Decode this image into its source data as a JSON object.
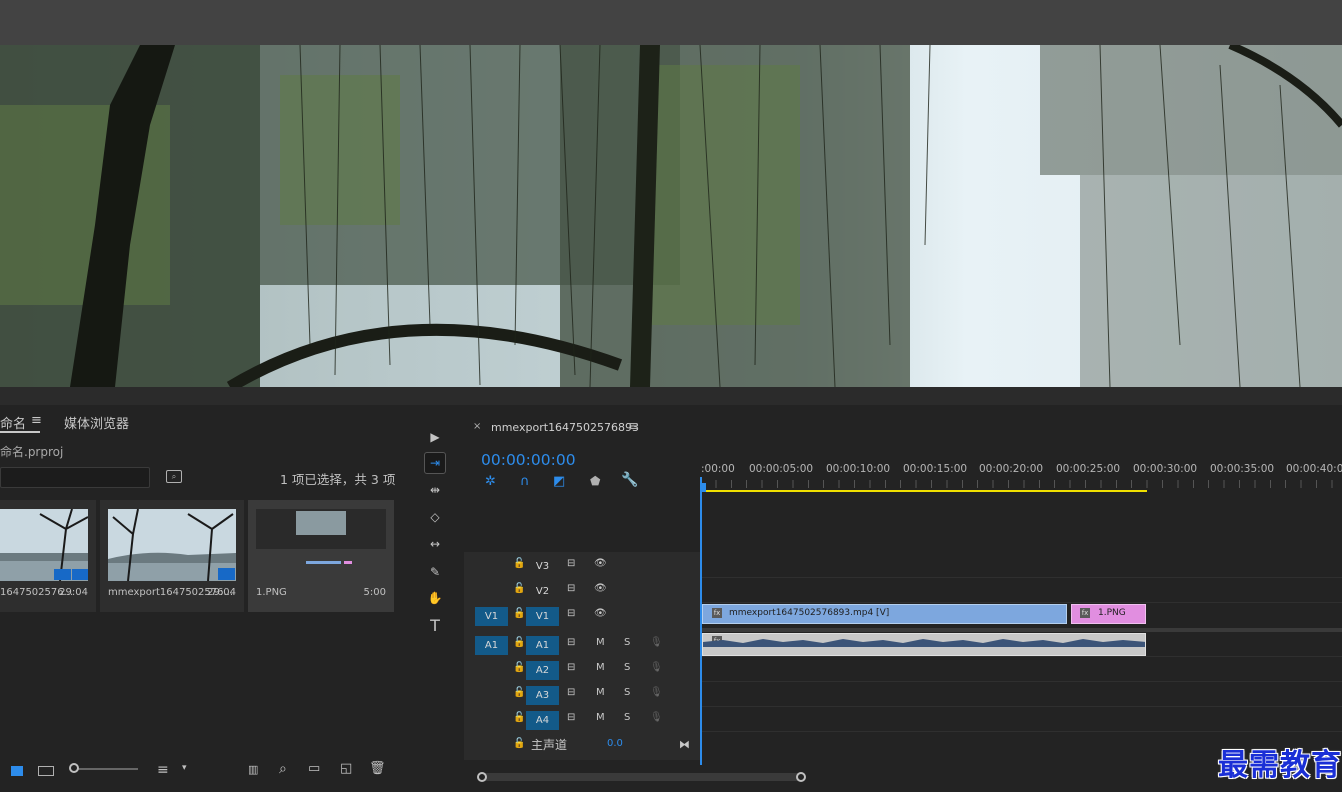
{
  "colors": {
    "accent": "#2d8ceb",
    "panel": "#232323",
    "track_header_active": "#135a89",
    "clip_video": "#7da7de",
    "clip_image": "#e18ee0",
    "work_area": "#f0e000"
  },
  "project": {
    "tab_project": "命名",
    "tab_menu_icon": "hamburger-icon",
    "tab_media_browser": "媒体浏览器",
    "project_file": "命名.prproj",
    "selection_status": "1 项已选择，共 3 项",
    "items": [
      {
        "name": "1647502576...",
        "duration": "29:04"
      },
      {
        "name": "mmexport1647502576...",
        "duration": "29:04"
      },
      {
        "name": "1.PNG",
        "duration": "5:00"
      }
    ]
  },
  "tools": [
    "selection-tool",
    "track-select-tool",
    "ripple-edit-tool",
    "razor-tool",
    "slip-tool",
    "pen-tool",
    "hand-tool",
    "type-tool"
  ],
  "timeline": {
    "close_glyph": "×",
    "sequence_name": "mmexport1647502576893",
    "timecode": "00:00:00:00",
    "ruler": [
      ":00:00",
      "00:00:05:00",
      "00:00:10:00",
      "00:00:15:00",
      "00:00:20:00",
      "00:00:25:00",
      "00:00:30:00",
      "00:00:35:00",
      "00:00:40:00"
    ],
    "video_tracks": [
      "V3",
      "V2",
      "V1"
    ],
    "audio_tracks": [
      "A1",
      "A2",
      "A3",
      "A4"
    ],
    "source_v": "V1",
    "source_a": "A1",
    "mute_label": "M",
    "solo_label": "S",
    "master_label": "主声道",
    "master_value": "0.0",
    "clips": {
      "video": "mmexport1647502576893.mp4 [V]",
      "image": "1.PNG"
    }
  },
  "watermark": "最需教育"
}
